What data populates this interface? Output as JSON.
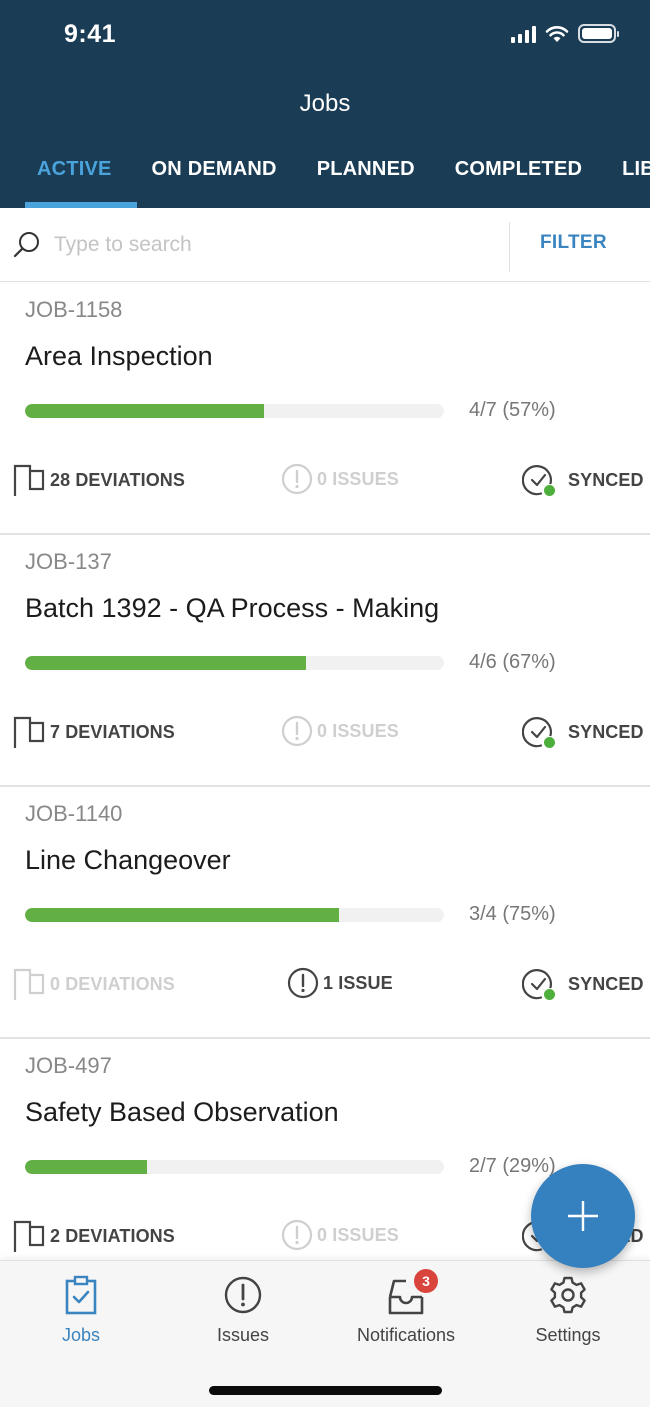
{
  "status_bar": {
    "time": "9:41"
  },
  "header": {
    "title": "Jobs",
    "tabs": [
      {
        "label": "ACTIVE",
        "active": true
      },
      {
        "label": "ON DEMAND",
        "active": false
      },
      {
        "label": "PLANNED",
        "active": false
      },
      {
        "label": "COMPLETED",
        "active": false
      },
      {
        "label": "LIBRARY",
        "active": false
      }
    ]
  },
  "search": {
    "placeholder": "Type to search",
    "value": "",
    "filter_label": "FILTER"
  },
  "jobs": [
    {
      "id": "JOB-1158",
      "title": "Area Inspection",
      "progress_text": "4/7 (57%)",
      "progress": 0.57,
      "deviations": "28 DEVIATIONS",
      "deviations_active": true,
      "issues": "0 ISSUES",
      "issues_active": false,
      "sync": "SYNCED"
    },
    {
      "id": "JOB-137",
      "title": "Batch 1392 - QA Process - Making",
      "progress_text": "4/6 (67%)",
      "progress": 0.67,
      "deviations": "7 DEVIATIONS",
      "deviations_active": true,
      "issues": "0 ISSUES",
      "issues_active": false,
      "sync": "SYNCED"
    },
    {
      "id": "JOB-1140",
      "title": "Line Changeover",
      "progress_text": "3/4 (75%)",
      "progress": 0.75,
      "deviations": "0 DEVIATIONS",
      "deviations_active": false,
      "issues": "1 ISSUE",
      "issues_active": true,
      "sync": "SYNCED"
    },
    {
      "id": "JOB-497",
      "title": "Safety Based Observation",
      "progress_text": "2/7 (29%)",
      "progress": 0.29,
      "deviations": "2 DEVIATIONS",
      "deviations_active": true,
      "issues": "0 ISSUES",
      "issues_active": false,
      "sync": "SYNCED"
    }
  ],
  "fab": {
    "icon": "plus-icon"
  },
  "bottom_nav": {
    "items": [
      {
        "label": "Jobs",
        "icon": "clipboard-check-icon",
        "active": true
      },
      {
        "label": "Issues",
        "icon": "exclamation-circle-icon",
        "active": false
      },
      {
        "label": "Notifications",
        "icon": "inbox-icon",
        "active": false,
        "badge": "3"
      },
      {
        "label": "Settings",
        "icon": "gear-icon",
        "active": false
      }
    ]
  },
  "colors": {
    "header_bg": "#1a3c55",
    "accent": "#3a84bf",
    "tab_active": "#4ba3dc",
    "progress": "#62b044",
    "synced_dot": "#4caf3c",
    "badge": "#d9443c"
  }
}
